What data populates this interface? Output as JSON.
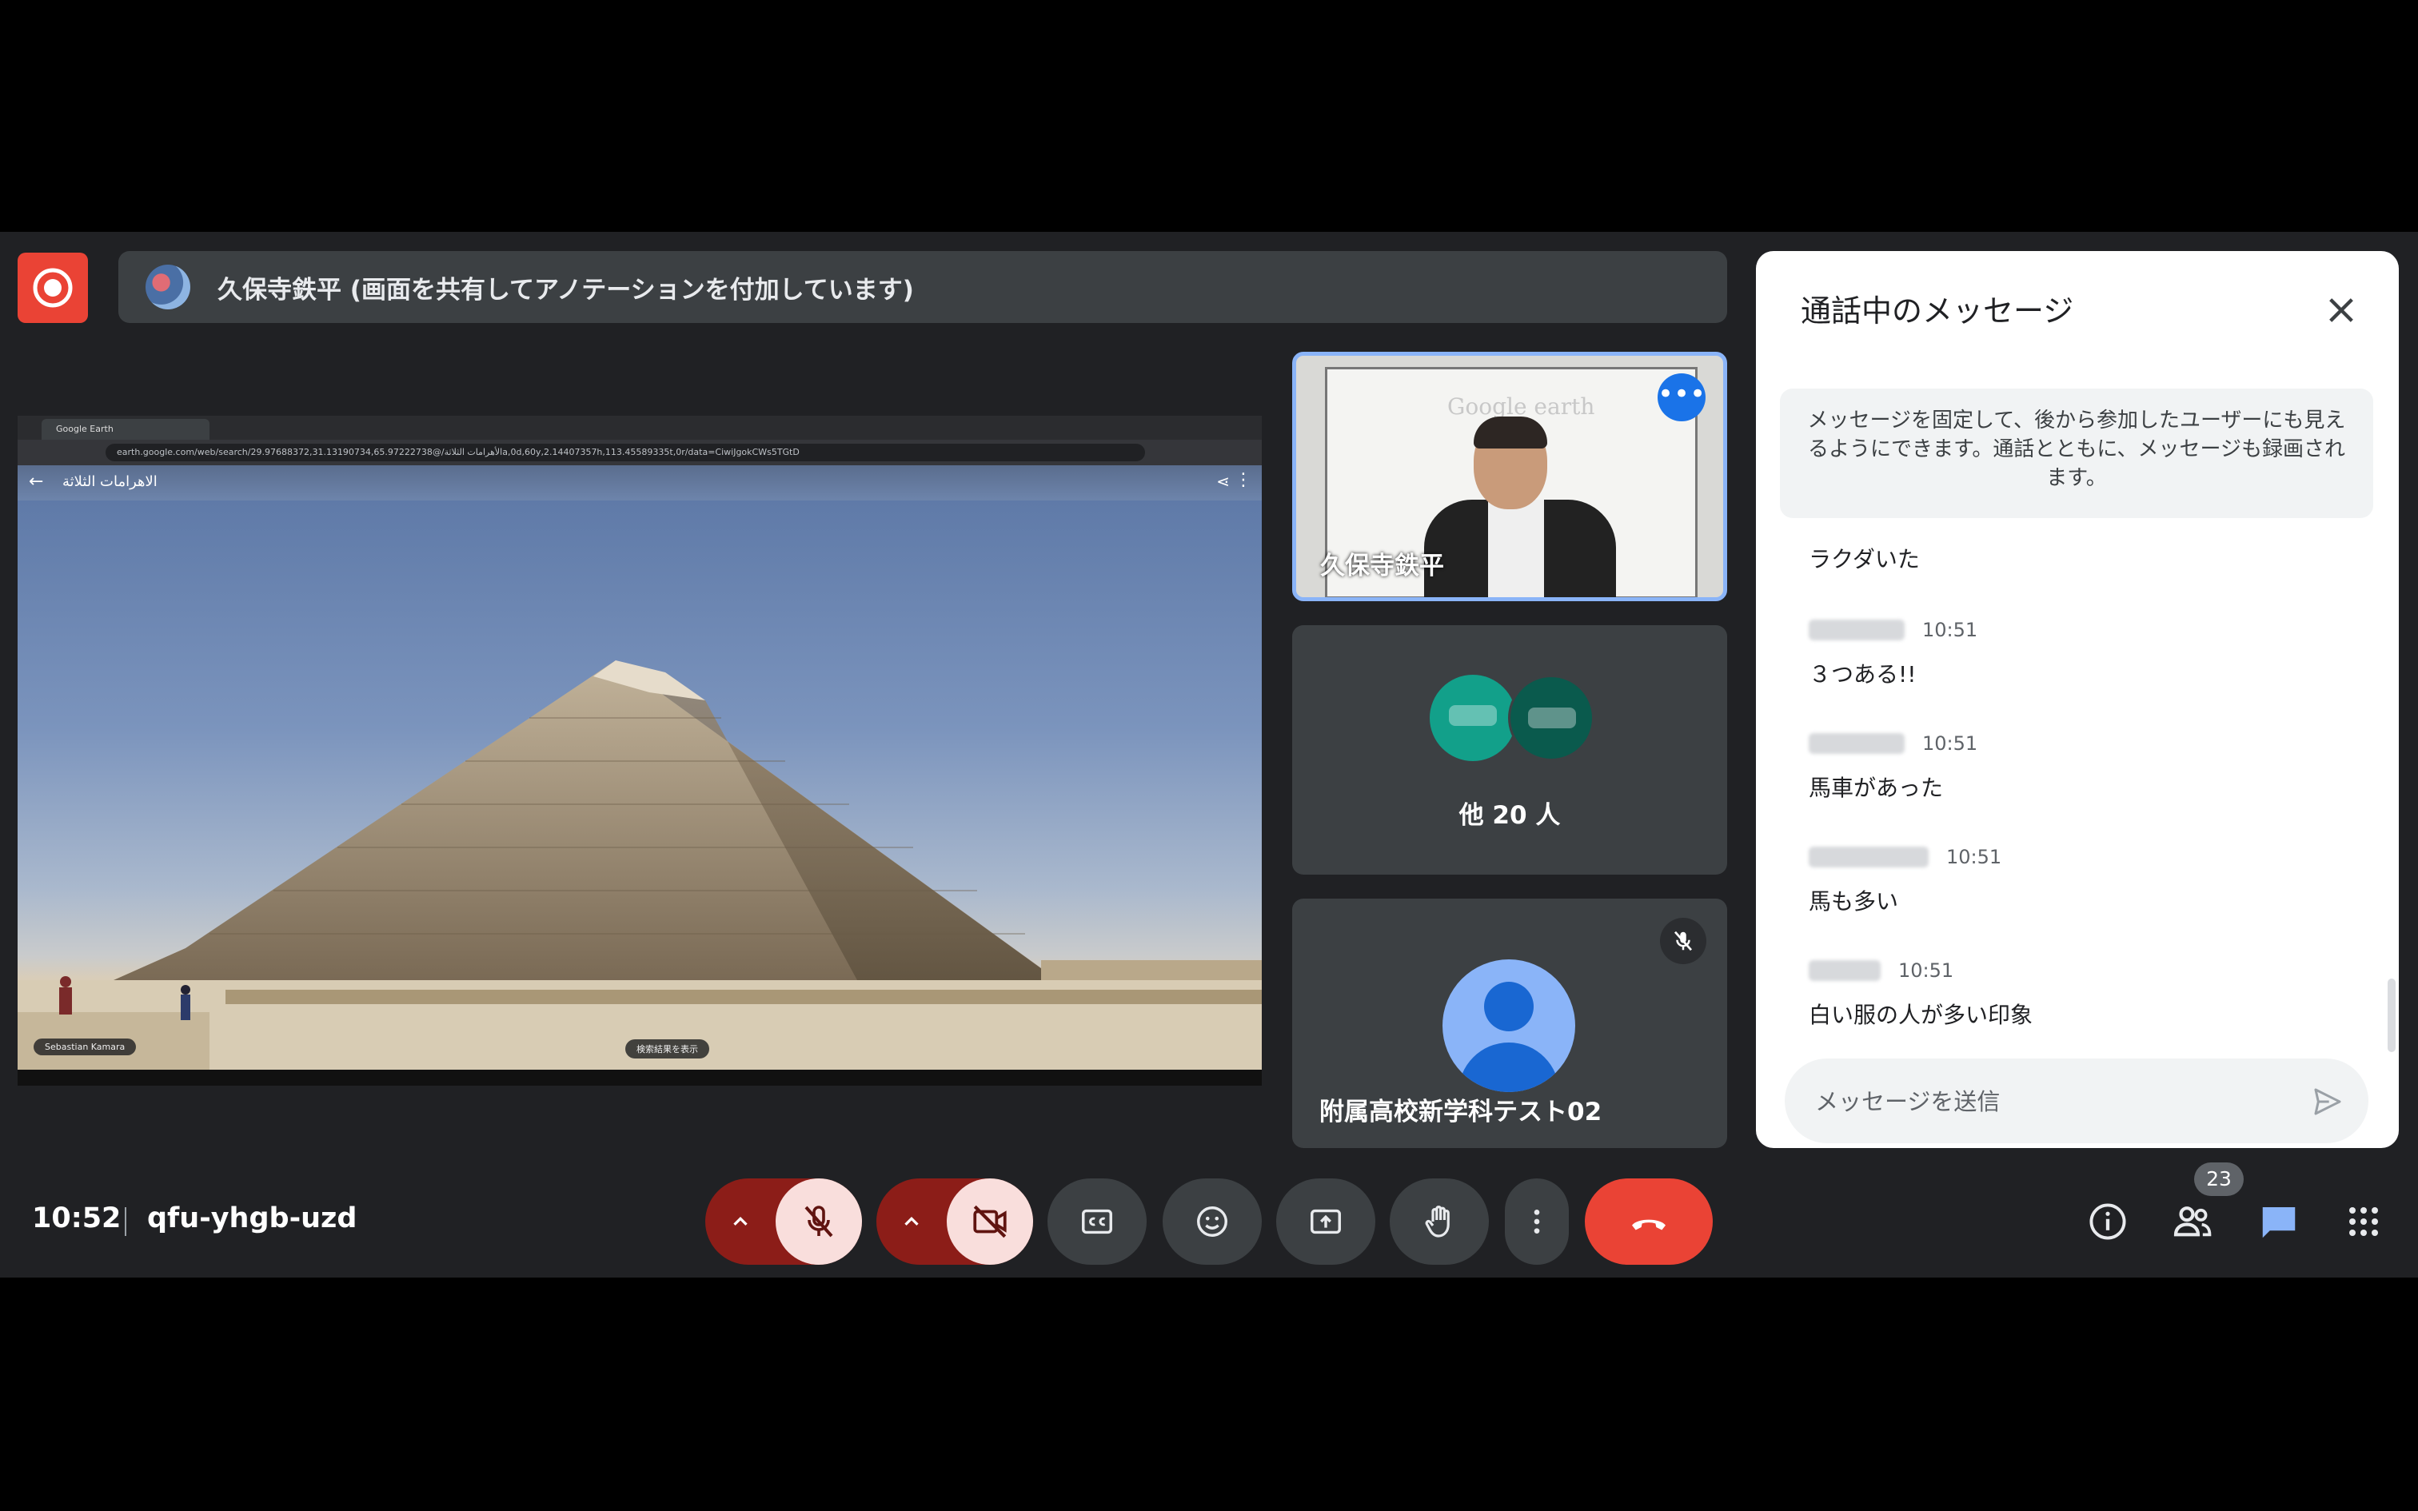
{
  "presenter": {
    "banner": "久保寺鉄平 (画面を共有してアノテーションを付加しています)"
  },
  "shared_screen": {
    "tab_title": "Google Earth",
    "url": "earth.google.com/web/search/الأهرامات الثلاثة/@29.97688372,31.13190734,65.97222738a,0d,60y,2.14407357h,113.45589335t,0r/data=CiwiJgokCWs5TGtD",
    "place_title": "الاهرامات الثلاثة",
    "credit": "Sebastian Kamara",
    "button_label": "検索結果を表示"
  },
  "tiles": {
    "main_speaker": {
      "name": "久保寺鉄平",
      "whiteboard_text": "Google earth"
    },
    "others": {
      "label": "他 20 人"
    },
    "participant": {
      "name": "附属高校新学科テスト02"
    }
  },
  "chat": {
    "title": "通話中のメッセージ",
    "notice": "メッセージを固定して、後から参加したユーザーにも見えるようにできます。通話とともに、メッセージも録画されます。",
    "first_message": "ラクダいた",
    "messages": [
      {
        "time": "10:51",
        "text": "３つある!!"
      },
      {
        "time": "10:51",
        "text": "馬車があった"
      },
      {
        "time": "10:51",
        "text": "馬も多い"
      },
      {
        "time": "10:51",
        "text": "白い服の人が多い印象"
      }
    ],
    "input_placeholder": "メッセージを送信"
  },
  "bottom_bar": {
    "time": "10:52",
    "meeting_code": "qfu-yhgb-uzd",
    "people_count": "23"
  },
  "colors": {
    "accent_blue": "#8ab4f8",
    "leave_red": "#ea4335",
    "control_gray": "#3c4043",
    "off_dark_red": "#8c1d18",
    "off_pink": "#f9dedc"
  }
}
